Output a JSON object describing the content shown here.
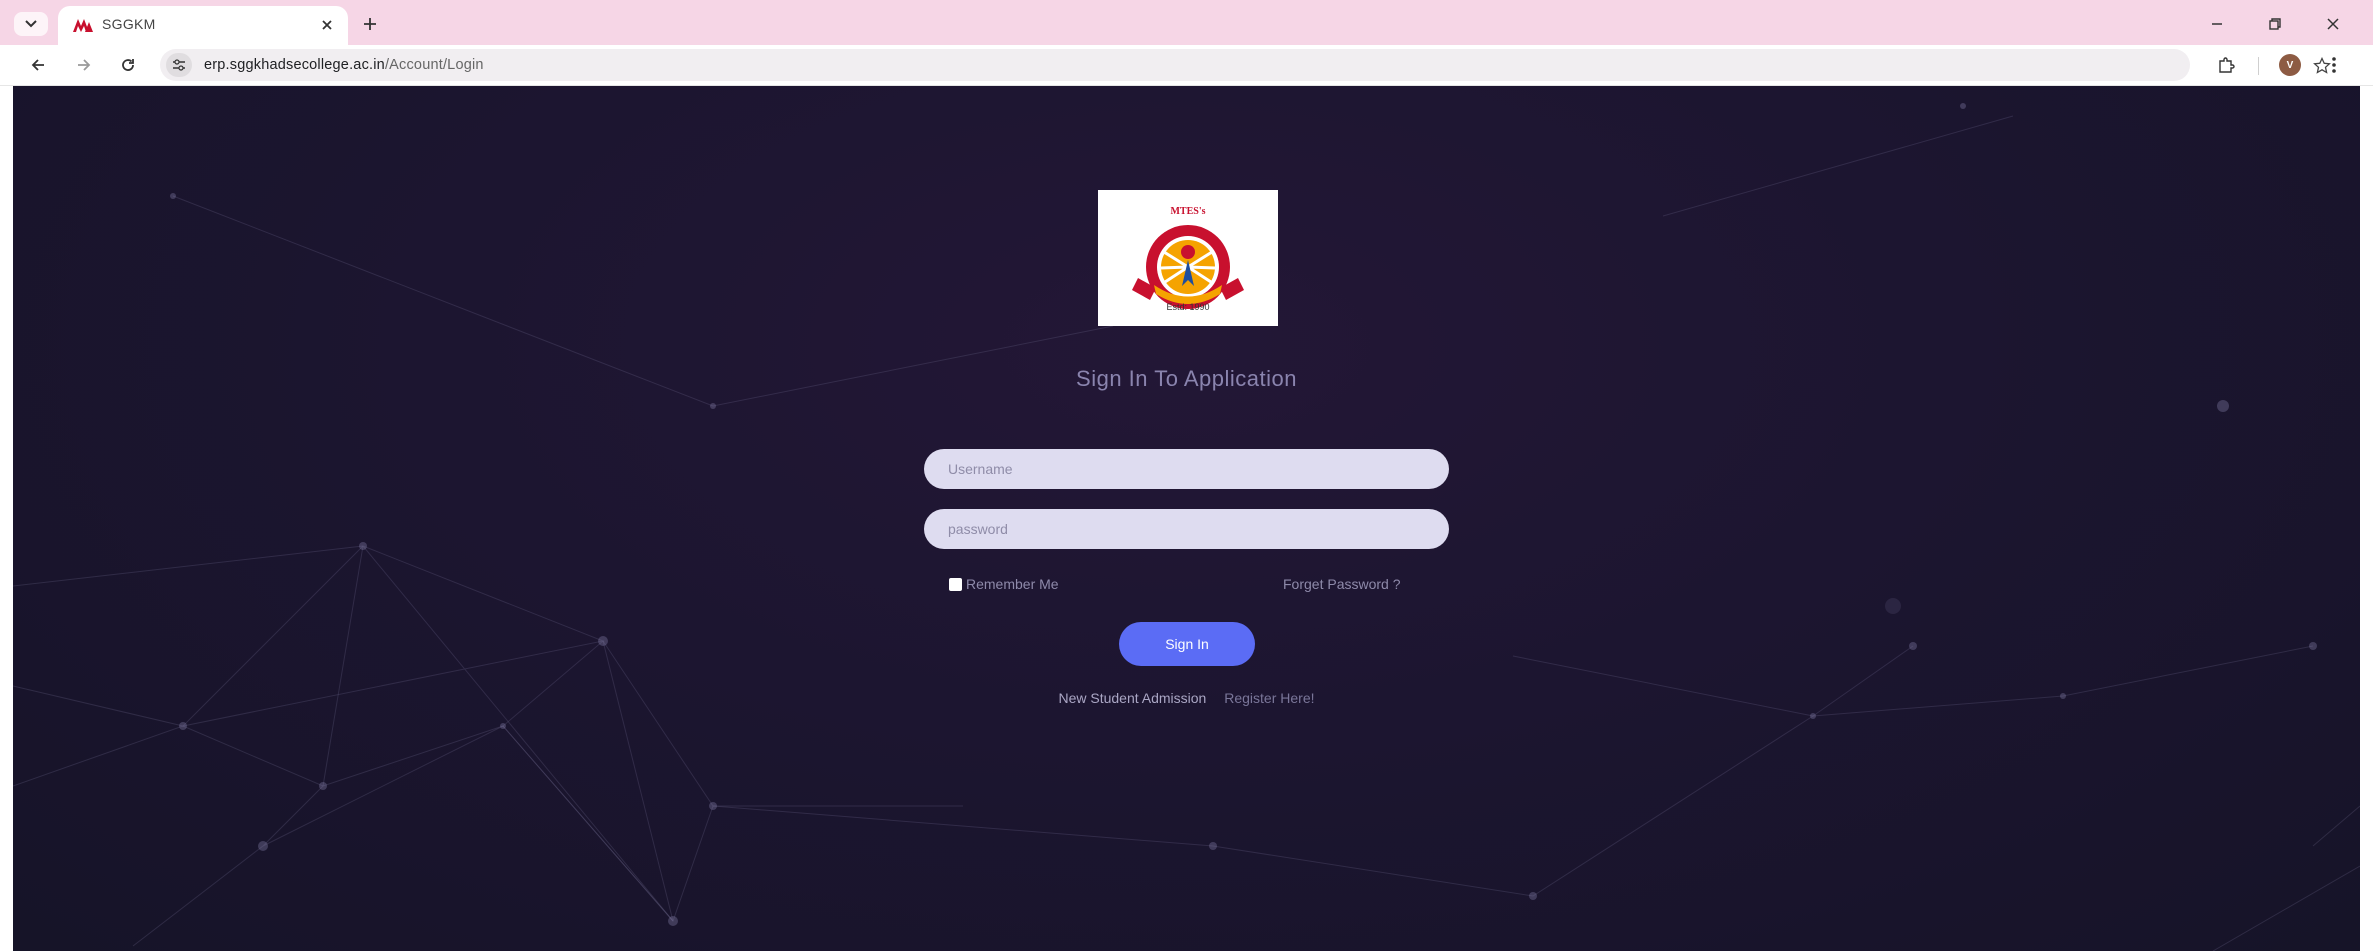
{
  "browser": {
    "tab": {
      "title": "SGGKM",
      "favicon": "m-logo-icon"
    },
    "url": {
      "host": "erp.sggkhadsecollege.ac.in",
      "path": "/Account/Login"
    },
    "avatar_letter": "V"
  },
  "page": {
    "logo": {
      "top_text": "MTES's",
      "estd_text": "Estd: 1990"
    },
    "heading": "Sign In To Application",
    "username": {
      "placeholder": "Username",
      "value": ""
    },
    "password": {
      "placeholder": "password",
      "value": ""
    },
    "remember_label": "Remember Me",
    "forgot_label": "Forget Password ?",
    "signin_label": "Sign In",
    "admission_label": "New Student Admission",
    "register_label": "Register Here!"
  },
  "colors": {
    "tabstrip": "#f6d6e6",
    "page_background": "#1c1530",
    "input_fill": "#dedcf0",
    "signin_button": "#5b6cf5",
    "logo_red": "#c8102e",
    "logo_orange": "#f5a300"
  }
}
